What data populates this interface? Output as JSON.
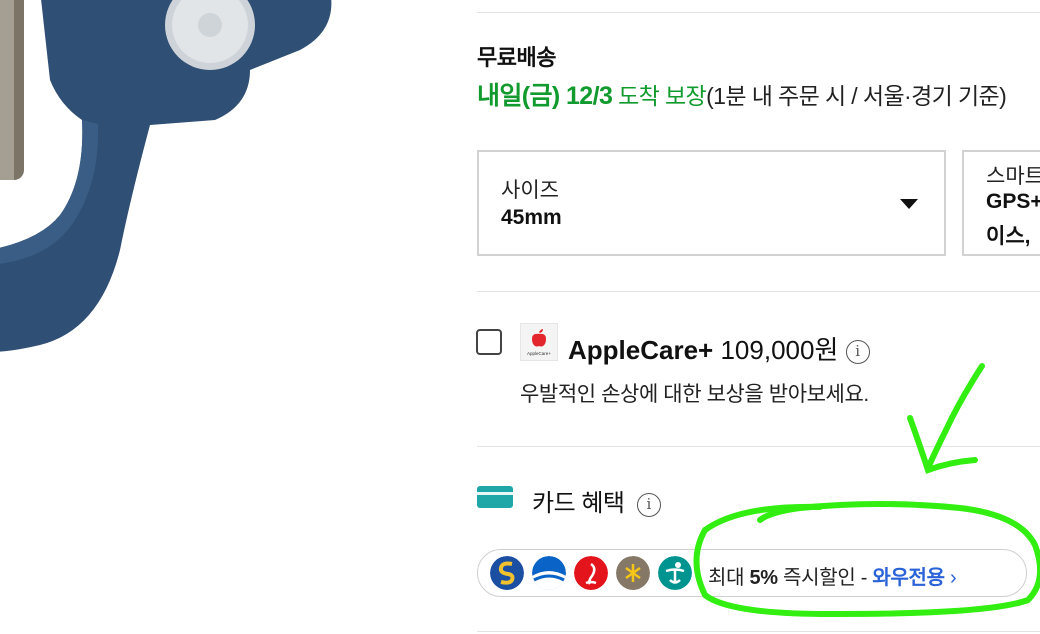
{
  "shipping": {
    "title": "무료배송",
    "date": "내일(금) 12/3",
    "guarantee": "도착 보장",
    "condition": "(1분  내 주문 시 / 서울·경기 기준)"
  },
  "options": [
    {
      "label": "사이즈",
      "value": "45mm"
    },
    {
      "label": "스마트",
      "value": "GPS+",
      "value2": "이스,"
    }
  ],
  "applecare": {
    "logo_text": "AppleCare+",
    "name": "AppleCare+",
    "price": "109,000원",
    "description": "우발적인 손상에 대한 보상을 받아보세요."
  },
  "card_benefit": {
    "title": "카드 혜택",
    "banks": [
      "shinhan-icon",
      "woori-icon",
      "lotte-icon",
      "kb-icon",
      "hana-icon"
    ],
    "text_prefix": "최대",
    "text_rate": "5%",
    "text_suffix": "즉시할인 -",
    "text_link": "와우전용",
    "text_chevron": "›"
  },
  "colors": {
    "green": "#119a2d",
    "blue_link": "#2a62d8",
    "band": "#2f4f74",
    "annotation": "#33ee11"
  }
}
